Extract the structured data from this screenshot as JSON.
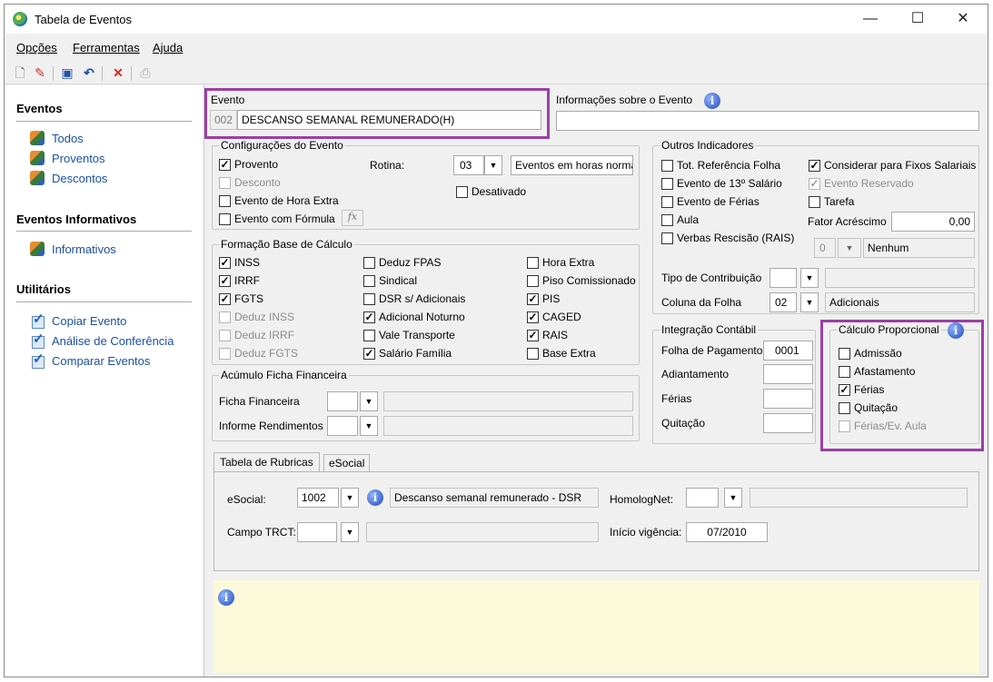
{
  "window": {
    "title": "Tabela de Eventos",
    "minimize": "—",
    "maximize": "☐",
    "close": "✕"
  },
  "menu": [
    "Opções",
    "Ferramentas",
    "Ajuda"
  ],
  "sidebar": {
    "eventos": {
      "heading": "Eventos",
      "items": [
        "Todos",
        "Proventos",
        "Descontos"
      ]
    },
    "informativos": {
      "heading": "Eventos Informativos",
      "items": [
        "Informativos"
      ]
    },
    "utilitarios": {
      "heading": "Utilitários",
      "items": [
        "Copiar Evento",
        "Análise de Conferência",
        "Comparar Eventos"
      ]
    }
  },
  "evento": {
    "label": "Evento",
    "code": "002",
    "name": "DESCANSO SEMANAL REMUNERADO(H)"
  },
  "info_evento": {
    "label": "Informações sobre o Evento",
    "value": ""
  },
  "config": {
    "title": "Configurações do Evento",
    "provento": "Provento",
    "desconto": "Desconto",
    "hora_extra": "Evento de Hora Extra",
    "formula": "Evento com Fórmula",
    "fx": "fx",
    "rotina_label": "Rotina:",
    "rotina_code": "03",
    "rotina_desc": "Eventos em horas norma",
    "desativado": "Desativado"
  },
  "base": {
    "title": "Formação Base de Cálculo",
    "col1": [
      {
        "l": "INSS",
        "c": true,
        "d": false
      },
      {
        "l": "IRRF",
        "c": true,
        "d": false
      },
      {
        "l": "FGTS",
        "c": true,
        "d": false
      },
      {
        "l": "Deduz INSS",
        "c": false,
        "d": true
      },
      {
        "l": "Deduz IRRF",
        "c": false,
        "d": true
      },
      {
        "l": "Deduz FGTS",
        "c": false,
        "d": true
      }
    ],
    "col2": [
      {
        "l": "Deduz FPAS",
        "c": false,
        "d": false
      },
      {
        "l": "Sindical",
        "c": false,
        "d": false
      },
      {
        "l": "DSR s/ Adicionais",
        "c": false,
        "d": false
      },
      {
        "l": "Adicional Noturno",
        "c": true,
        "d": false
      },
      {
        "l": "Vale Transporte",
        "c": false,
        "d": false
      },
      {
        "l": "Salário Família",
        "c": true,
        "d": false
      }
    ],
    "col3": [
      {
        "l": "Hora Extra",
        "c": false,
        "d": false
      },
      {
        "l": "Piso Comissionado",
        "c": false,
        "d": false
      },
      {
        "l": "PIS",
        "c": true,
        "d": false
      },
      {
        "l": "CAGED",
        "c": true,
        "d": false
      },
      {
        "l": "RAIS",
        "c": true,
        "d": false
      },
      {
        "l": "Base Extra",
        "c": false,
        "d": false
      }
    ]
  },
  "acumulo": {
    "title": "Acúmulo Ficha Financeira",
    "ficha": "Ficha Financeira",
    "informe": "Informe Rendimentos"
  },
  "outros": {
    "title": "Outros Indicadores",
    "left": [
      {
        "l": "Tot. Referência Folha",
        "c": false,
        "d": false
      },
      {
        "l": "Evento de 13º Salário",
        "c": false,
        "d": false
      },
      {
        "l": "Evento de Férias",
        "c": false,
        "d": false
      },
      {
        "l": "Aula",
        "c": false,
        "d": false
      },
      {
        "l": "Verbas Rescisão (RAIS)",
        "c": false,
        "d": false
      }
    ],
    "right": [
      {
        "l": "Considerar para Fixos Salariais",
        "c": true,
        "d": false
      },
      {
        "l": "Evento Reservado",
        "c": true,
        "d": true
      },
      {
        "l": "Tarefa",
        "c": false,
        "d": false
      }
    ],
    "fator_label": "Fator Acréscimo",
    "fator_value": "0,00",
    "verbas_code": "0",
    "verbas_desc": "Nenhum",
    "tipo_label": "Tipo de Contribuição",
    "coluna_label": "Coluna da Folha",
    "coluna_code": "02",
    "coluna_desc": "Adicionais"
  },
  "integracao": {
    "title": "Integração Contábil",
    "folha": "Folha de Pagamento",
    "folha_value": "0001",
    "adiantamento": "Adiantamento",
    "ferias": "Férias",
    "quitacao": "Quitação"
  },
  "calculo": {
    "title": "Cálculo Proporcional",
    "items": [
      {
        "l": "Admissão",
        "c": false,
        "d": false
      },
      {
        "l": "Afastamento",
        "c": false,
        "d": false
      },
      {
        "l": "Férias",
        "c": true,
        "d": false
      },
      {
        "l": "Quitação",
        "c": false,
        "d": false
      },
      {
        "l": "Férias/Ev. Aula",
        "c": false,
        "d": true
      }
    ]
  },
  "tabs": {
    "t1": "Tabela de Rubricas",
    "t2": "eSocial"
  },
  "rubricas": {
    "esocial_label": "eSocial:",
    "esocial_code": "1002",
    "esocial_desc": "Descanso semanal remunerado - DSR",
    "homolognet": "HomologNet:",
    "trct": "Campo TRCT:",
    "inicio_label": "Início vigência:",
    "inicio_value": "07/2010"
  },
  "check_mark": "✓",
  "dd_arrow": "▼",
  "info_icon": "i",
  "colors": {
    "highlight": "#9b3fa4",
    "note_bg": "#fcfadb",
    "link": "#1c4fa8"
  }
}
